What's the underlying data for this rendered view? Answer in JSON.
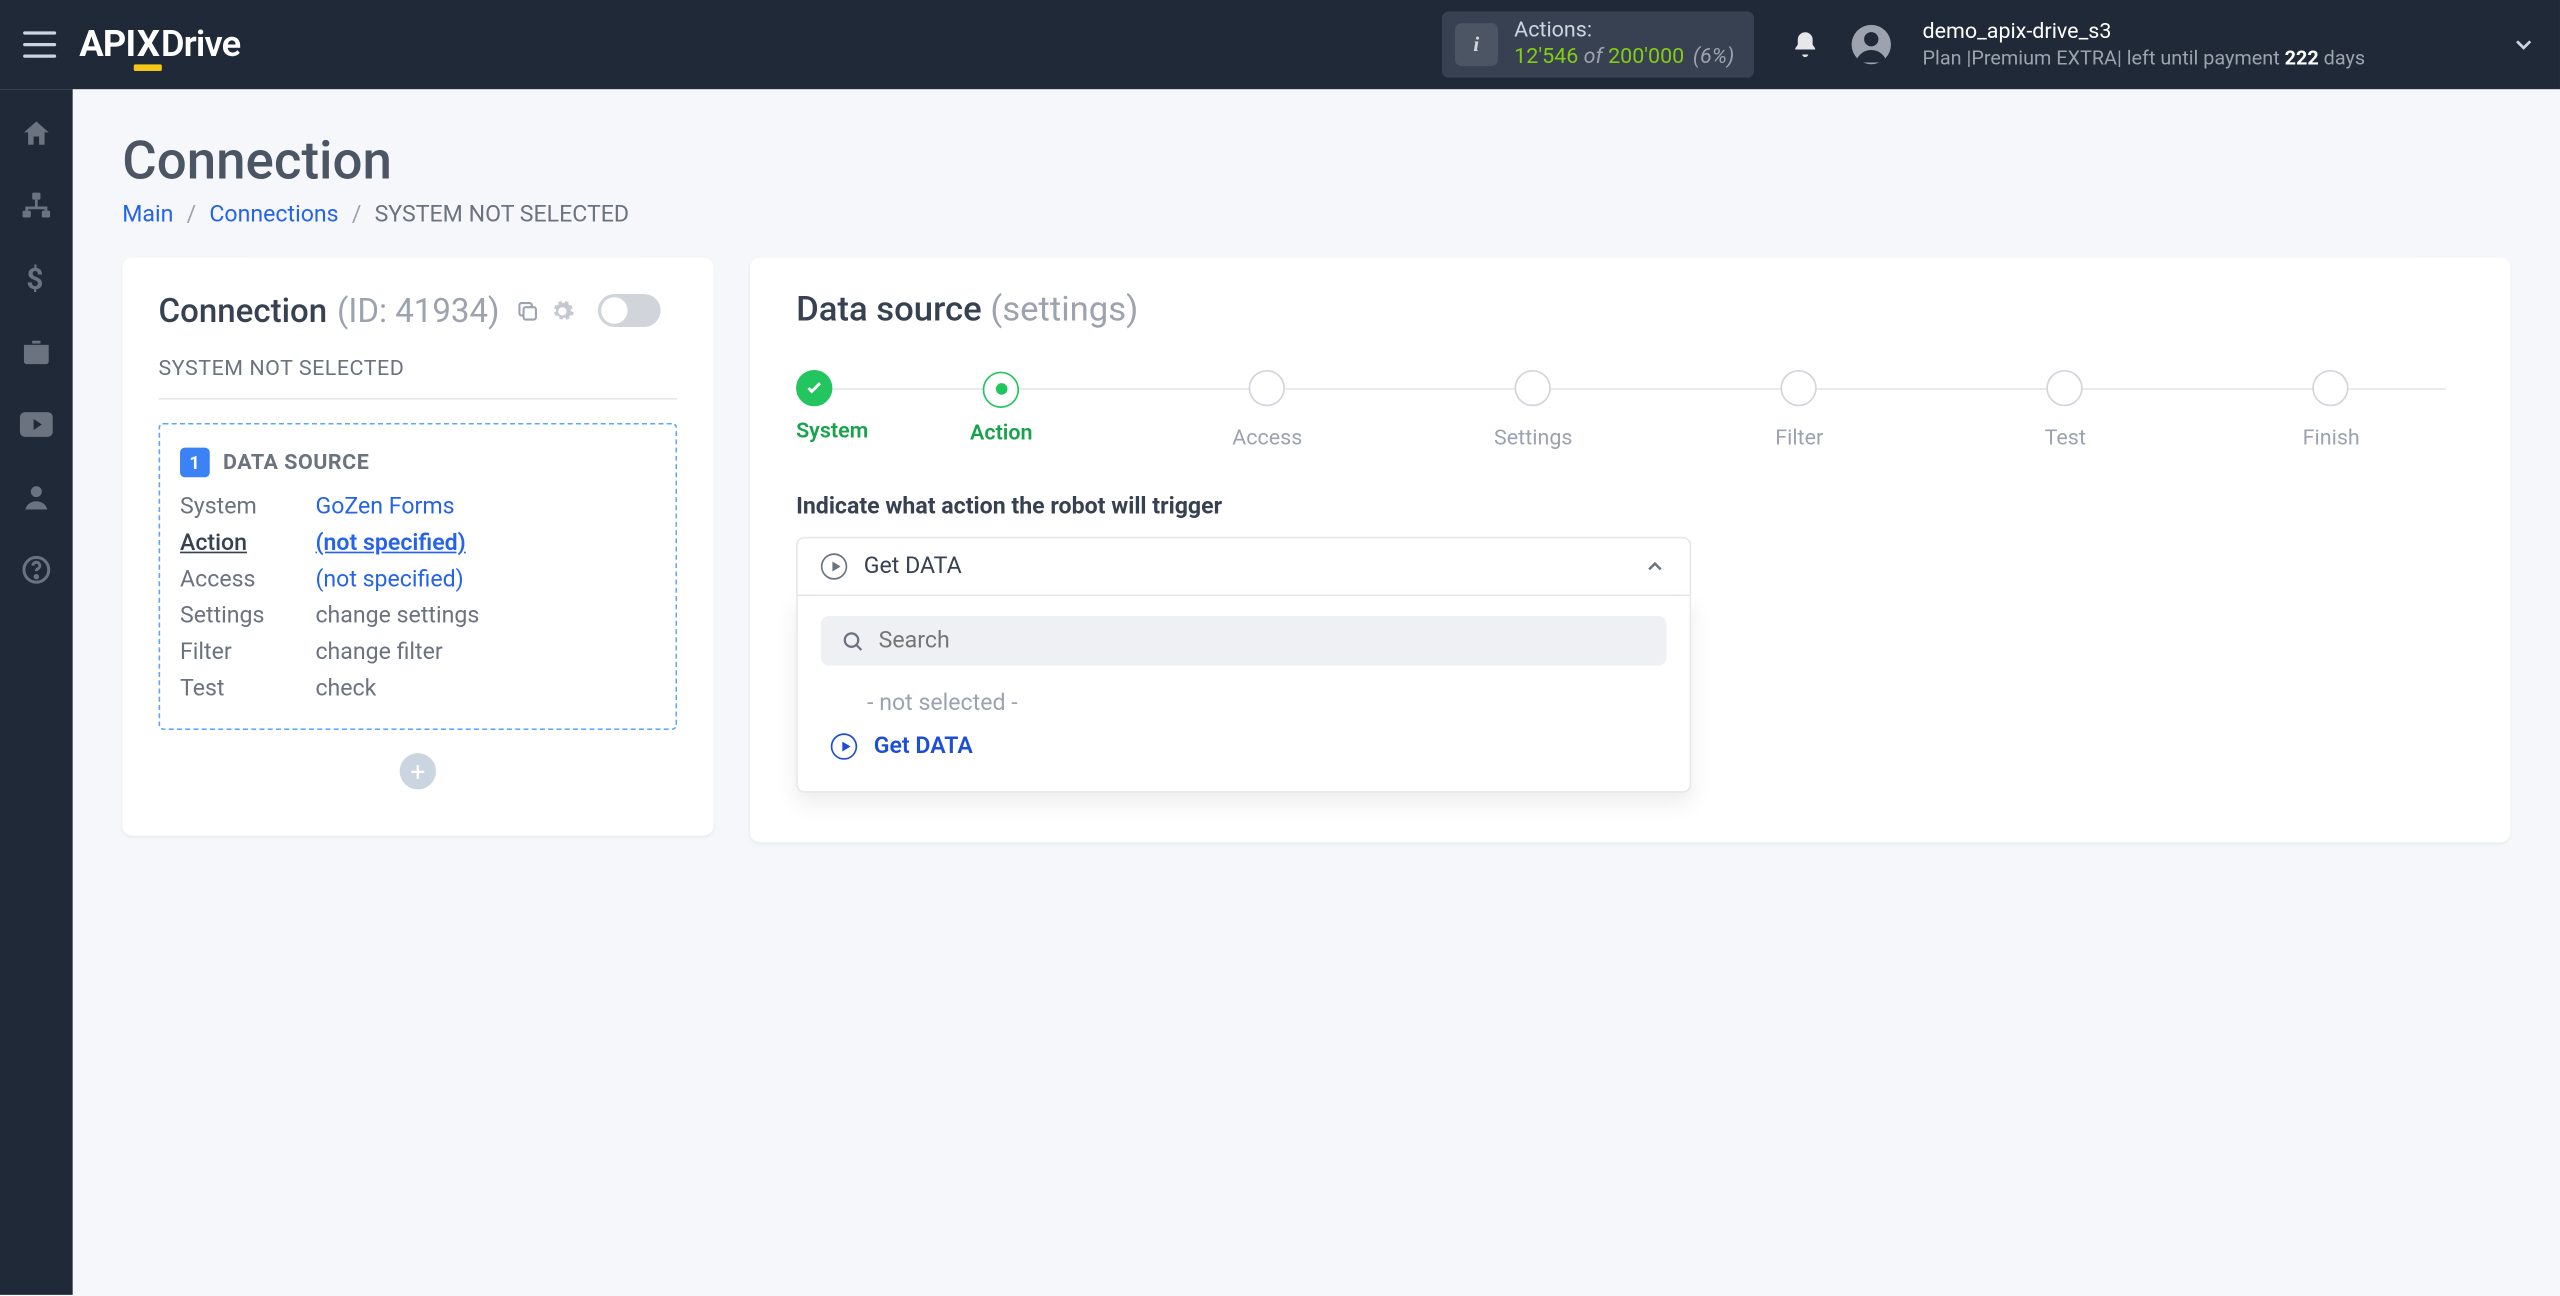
{
  "header": {
    "logo": {
      "part1": "API",
      "part2": "X",
      "part3": "Drive"
    },
    "actions": {
      "label": "Actions:",
      "count": "12'546",
      "of": "of",
      "total": "200'000",
      "pct": "(6%)"
    },
    "user": {
      "name": "demo_apix-drive_s3",
      "plan_prefix": "Plan |",
      "plan_name": "Premium EXTRA",
      "plan_middle": "| left until payment ",
      "days": "222",
      "plan_suffix": " days"
    }
  },
  "leftrail": [
    "home",
    "sitemap",
    "dollar",
    "briefcase",
    "youtube",
    "user",
    "help"
  ],
  "page": {
    "title": "Connection",
    "crumbs": {
      "main": "Main",
      "connections": "Connections",
      "current": "SYSTEM NOT SELECTED"
    }
  },
  "sidecard": {
    "title": "Connection",
    "id_label": "(ID: 41934)",
    "status": "SYSTEM NOT SELECTED",
    "ds_badge": "1",
    "ds_title": "DATA SOURCE",
    "rows": [
      {
        "k": "System",
        "v": "GoZen Forms",
        "link": true,
        "und": false,
        "current": false
      },
      {
        "k": "Action",
        "v": "(not specified)",
        "link": true,
        "und": true,
        "current": true
      },
      {
        "k": "Access",
        "v": "(not specified)",
        "link": true,
        "und": false,
        "current": false
      },
      {
        "k": "Settings",
        "v": "change settings",
        "link": false,
        "und": false,
        "current": false
      },
      {
        "k": "Filter",
        "v": "change filter",
        "link": false,
        "und": false,
        "current": false
      },
      {
        "k": "Test",
        "v": "check",
        "link": false,
        "und": false,
        "current": false
      }
    ]
  },
  "main": {
    "title": "Data source",
    "subtitle": "(settings)",
    "steps": [
      "System",
      "Action",
      "Access",
      "Settings",
      "Filter",
      "Test",
      "Finish"
    ],
    "step_done_index": 0,
    "step_active_index": 1,
    "instruction": "Indicate what action the robot will trigger",
    "selected": "Get DATA",
    "search_placeholder": "Search",
    "options": {
      "not_selected": "- not selected -",
      "get_data": "Get DATA"
    }
  }
}
